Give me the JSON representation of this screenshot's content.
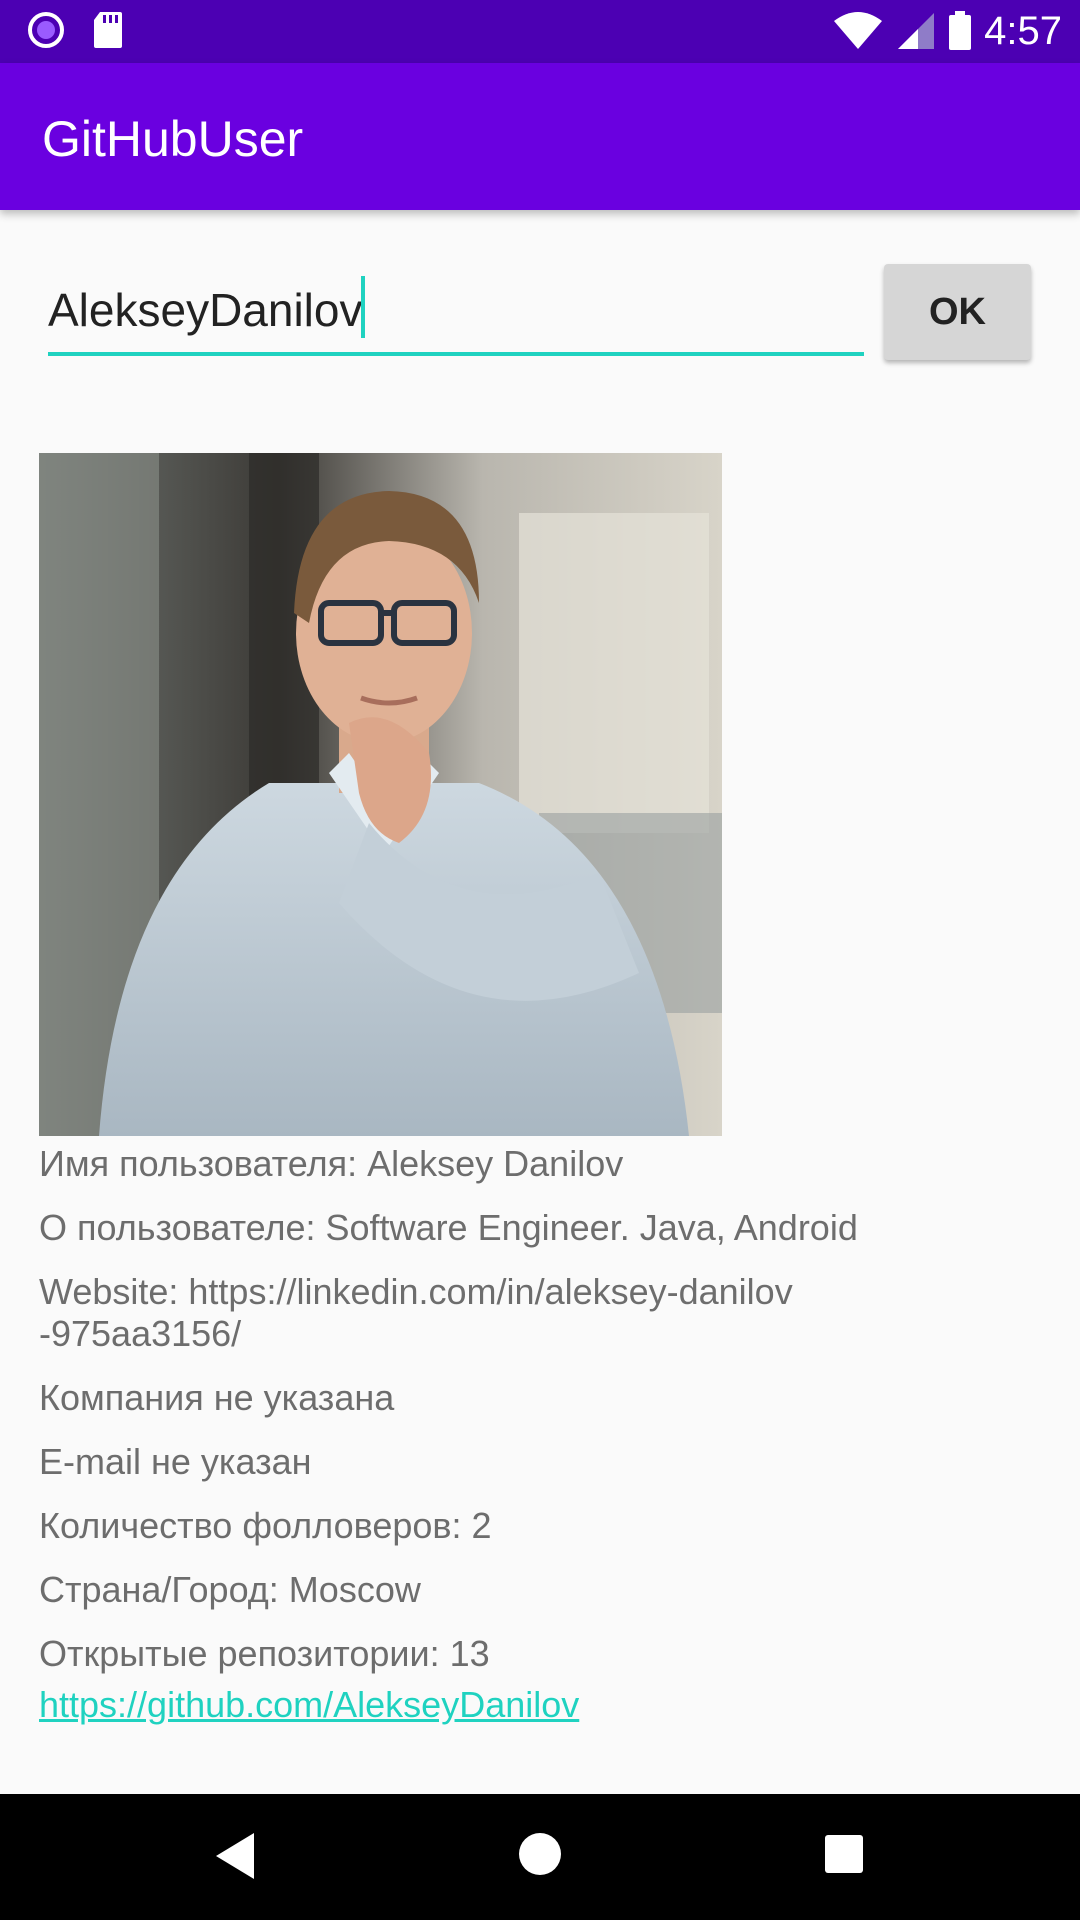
{
  "status_bar": {
    "time": "4:57",
    "icons": [
      "app-notification-icon",
      "sd-card-icon",
      "wifi-icon",
      "signal-icon",
      "battery-icon"
    ]
  },
  "app_bar": {
    "title": "GitHubUser"
  },
  "search": {
    "value": "AlekseyDanilov",
    "ok_label": "OK"
  },
  "profile": {
    "name_line": "Имя пользователя: Aleksey Danilov",
    "about_line": "О пользователе: Software Engineer. Java, Android",
    "website_line1": "Website: https://linkedin.com/in/aleksey-danilov",
    "website_line2": "-975aa3156/",
    "company_line": "Компания не указана",
    "email_line": "E-mail не указан",
    "followers_line": "Количество фолловеров: 2",
    "location_line": "Страна/Город: Moscow",
    "repos_line": "Открытые репозитории: 13",
    "github_link": "https://github.com/AlekseyDanilov"
  },
  "colors": {
    "status_bar": "#4c00b3",
    "app_bar": "#6a00e0",
    "accent": "#1fd2c0",
    "background": "#fafafa"
  }
}
